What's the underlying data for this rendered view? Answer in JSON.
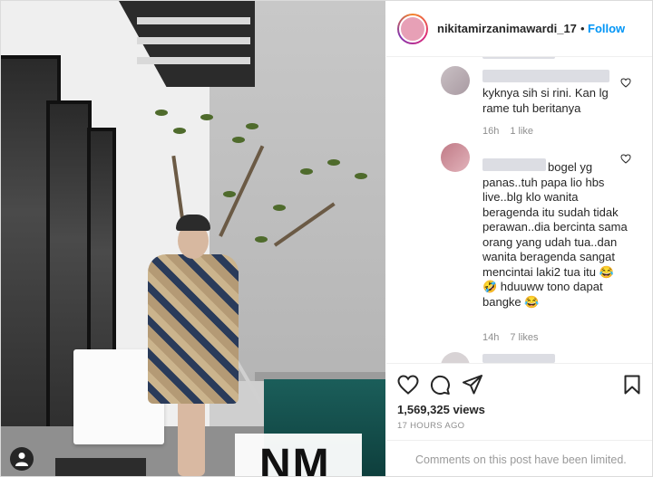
{
  "post": {
    "username": "nikitamirzanimawardi_17",
    "follow_label": "Follow",
    "separator": "•"
  },
  "media": {
    "watermark": "NM"
  },
  "comments": [
    {
      "text": "kyknya sih si rini. Kan lg rame tuh beritanya",
      "time": "16h",
      "likes": "1 like"
    },
    {
      "text": "bogel yg panas..tuh papa lio hbs live..blg klo wanita beragenda itu sudah tidak perawan..dia bercinta sama orang yang udah tua..dan wanita beragenda sangat mencintai laki2 tua itu 😂🤣 hduuww tono dapat bangke 😂",
      "time": "14h",
      "likes": "7 likes"
    }
  ],
  "stats": {
    "views": "1,569,325 views",
    "posted": "17 HOURS AGO"
  },
  "footer": {
    "limited_text": "Comments on this post have been limited."
  },
  "colors": {
    "accent": "#0095f6",
    "text": "#262626",
    "muted": "#8e8e8e"
  }
}
